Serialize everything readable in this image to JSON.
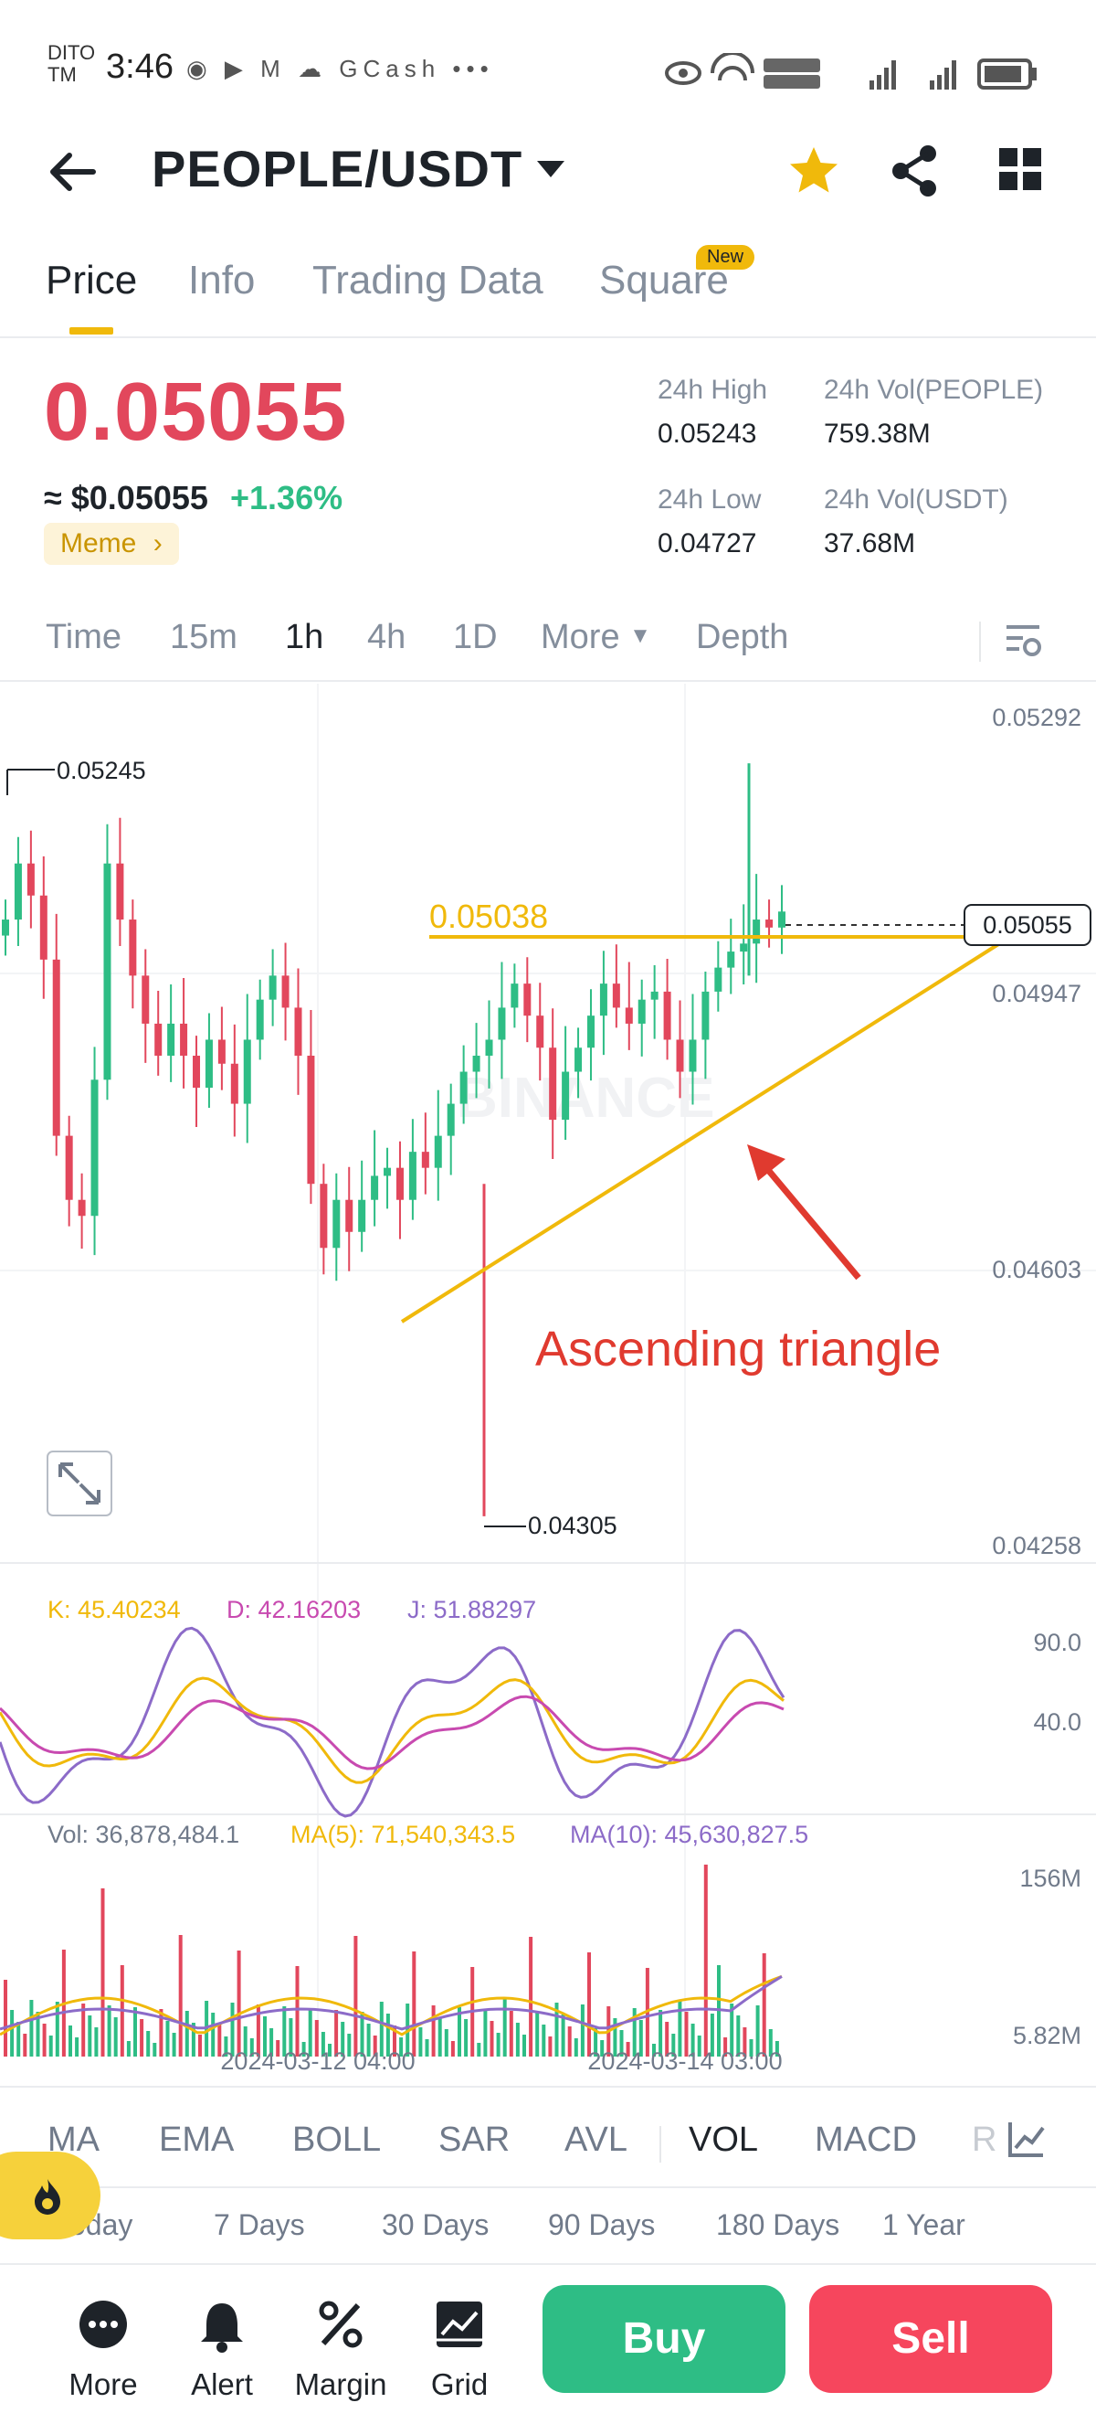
{
  "status_bar": {
    "carrier_line1": "DITO",
    "carrier_line2": "TM",
    "time": "3:46",
    "left_icons": "◉ ▶ M ☁ GCash •••",
    "right_icons": "◉ ⦿ VoLTE VoWiFi ▮▮▮ ▮▮▮ ▭"
  },
  "header": {
    "pair": "PEOPLE/USDT",
    "icons": [
      "back-arrow-icon",
      "caret-down-icon",
      "star-icon",
      "share-icon",
      "grid-icon"
    ]
  },
  "tabs": [
    {
      "label": "Price",
      "active": true
    },
    {
      "label": "Info",
      "active": false
    },
    {
      "label": "Trading Data",
      "active": false
    },
    {
      "label": "Square",
      "active": false
    }
  ],
  "new_badge": "New",
  "price": {
    "last": "0.05055",
    "fiat": "≈ $0.05055",
    "change": "+1.36%",
    "tag": "Meme",
    "tag_arrow": "›"
  },
  "stats": {
    "high_label": "24h High",
    "high_value": "0.05243",
    "low_label": "24h Low",
    "low_value": "0.04727",
    "vol_base_label": "24h Vol(PEOPLE)",
    "vol_base_value": "759.38M",
    "vol_quote_label": "24h Vol(USDT)",
    "vol_quote_value": "37.68M"
  },
  "intervals": [
    {
      "label": "Time",
      "active": false
    },
    {
      "label": "15m",
      "active": false
    },
    {
      "label": "1h",
      "active": true
    },
    {
      "label": "4h",
      "active": false
    },
    {
      "label": "1D",
      "active": false
    },
    {
      "label": "More",
      "active": false
    },
    {
      "label": "Depth",
      "active": false
    }
  ],
  "chart_labels": {
    "axis_top": "0.05292",
    "axis_current": "0.05055",
    "axis_2": "0.04947",
    "axis_3": "0.04603",
    "axis_bottom": "0.04258",
    "high_marker": "0.05245",
    "low_marker": "0.04305",
    "resistance_label": "0.05038",
    "annotation": "Ascending triangle",
    "watermark": "BINANCE",
    "kdj_k": "K: 45.40234",
    "kdj_d": "D: 42.16203",
    "kdj_j": "J: 51.88297",
    "kdj_axis_high": "90.0",
    "kdj_axis_low": "40.0",
    "vol_label": "Vol: 36,878,484.1",
    "vol_ma5": "MA(5): 71,540,343.5",
    "vol_ma10": "MA(10): 45,630,827.5",
    "vol_axis_high": "156M",
    "vol_axis_low": "5.82M",
    "date_1": "2024-03-12 04:00",
    "date_2": "2024-03-14 03:00"
  },
  "chart_data": {
    "type": "candlestick",
    "price_axis": [
      0.04258,
      0.04603,
      0.04947,
      0.05055,
      0.05292
    ],
    "ylim": [
      0.04258,
      0.05292
    ],
    "high": 0.05245,
    "low": 0.04305,
    "last": 0.05055,
    "resistance": 0.05038,
    "kdj": {
      "K": 45.40234,
      "D": 42.16203,
      "J": 51.88297,
      "axis": [
        40.0,
        90.0
      ]
    },
    "volume": {
      "vol": 36878484.1,
      "ma5": 71540343.5,
      "ma10": 45630827.5,
      "axis": [
        "5.82M",
        "156M"
      ]
    },
    "x_ticks": [
      "2024-03-12 04:00",
      "2024-03-14 03:00"
    ],
    "colors": {
      "up": "#2ebd85",
      "down": "#e2475c",
      "trendline": "#f0b90b",
      "arrow": "#e03a2f",
      "k": "#f0b90b",
      "d": "#c84ab0",
      "j": "#8c6bc8"
    }
  },
  "indicators": [
    {
      "label": "MA",
      "active": false
    },
    {
      "label": "EMA",
      "active": false
    },
    {
      "label": "BOLL",
      "active": false
    },
    {
      "label": "SAR",
      "active": false
    },
    {
      "label": "AVL",
      "active": false
    },
    {
      "label": "VOL",
      "active": true
    },
    {
      "label": "MACD",
      "active": false
    },
    {
      "label": "R",
      "active": false
    }
  ],
  "ranges": [
    "Today",
    "7 Days",
    "30 Days",
    "90 Days",
    "180 Days",
    "1 Year"
  ],
  "bottom_nav": [
    {
      "label": "More",
      "icon": "more-icon"
    },
    {
      "label": "Alert",
      "icon": "bell-icon"
    },
    {
      "label": "Margin",
      "icon": "percent-icon"
    },
    {
      "label": "Grid",
      "icon": "grid-bot-icon"
    }
  ],
  "buttons": {
    "buy": "Buy",
    "sell": "Sell"
  }
}
